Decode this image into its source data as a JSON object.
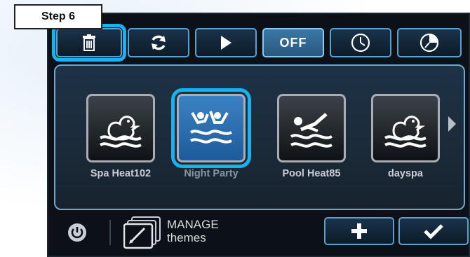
{
  "step_label": "Step 6",
  "toolbar": {
    "buttons": [
      {
        "name": "trash",
        "icon": "trash-icon",
        "selected": true
      },
      {
        "name": "refresh",
        "icon": "refresh-icon"
      },
      {
        "name": "play",
        "icon": "play-icon"
      },
      {
        "name": "off",
        "label": "OFF"
      },
      {
        "name": "clock",
        "icon": "clock-icon"
      },
      {
        "name": "dial",
        "icon": "dial-icon"
      }
    ]
  },
  "themes": [
    {
      "label": "Spa Heat102",
      "icon": "duck-icon"
    },
    {
      "label": "Night Party",
      "icon": "swimmers-icon",
      "selected": true
    },
    {
      "label": "Pool Heat85",
      "icon": "swimmer-icon"
    },
    {
      "label": "dayspa",
      "icon": "duck-icon"
    }
  ],
  "manage": {
    "line1": "MANAGE",
    "line2": "themes"
  },
  "colors": {
    "highlight": "#18b2f0",
    "button_border": "#5d9fce",
    "panel_bg": "#1e3246",
    "selected_theme": "#2f74b5"
  }
}
